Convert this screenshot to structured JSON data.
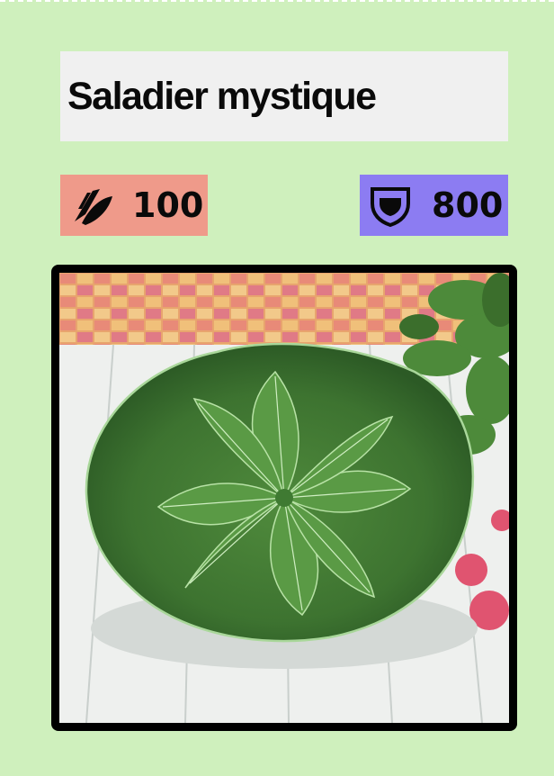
{
  "card": {
    "title": "Saladier mystique",
    "attack": {
      "value": "100",
      "icon": "claw-slash-icon",
      "color": "#ef9a8a"
    },
    "defense": {
      "value": "800",
      "icon": "shield-icon",
      "color": "#8c7cf2"
    },
    "artwork": {
      "icon": "leaf-bowl-artwork"
    },
    "background_color": "#cff0bd"
  }
}
